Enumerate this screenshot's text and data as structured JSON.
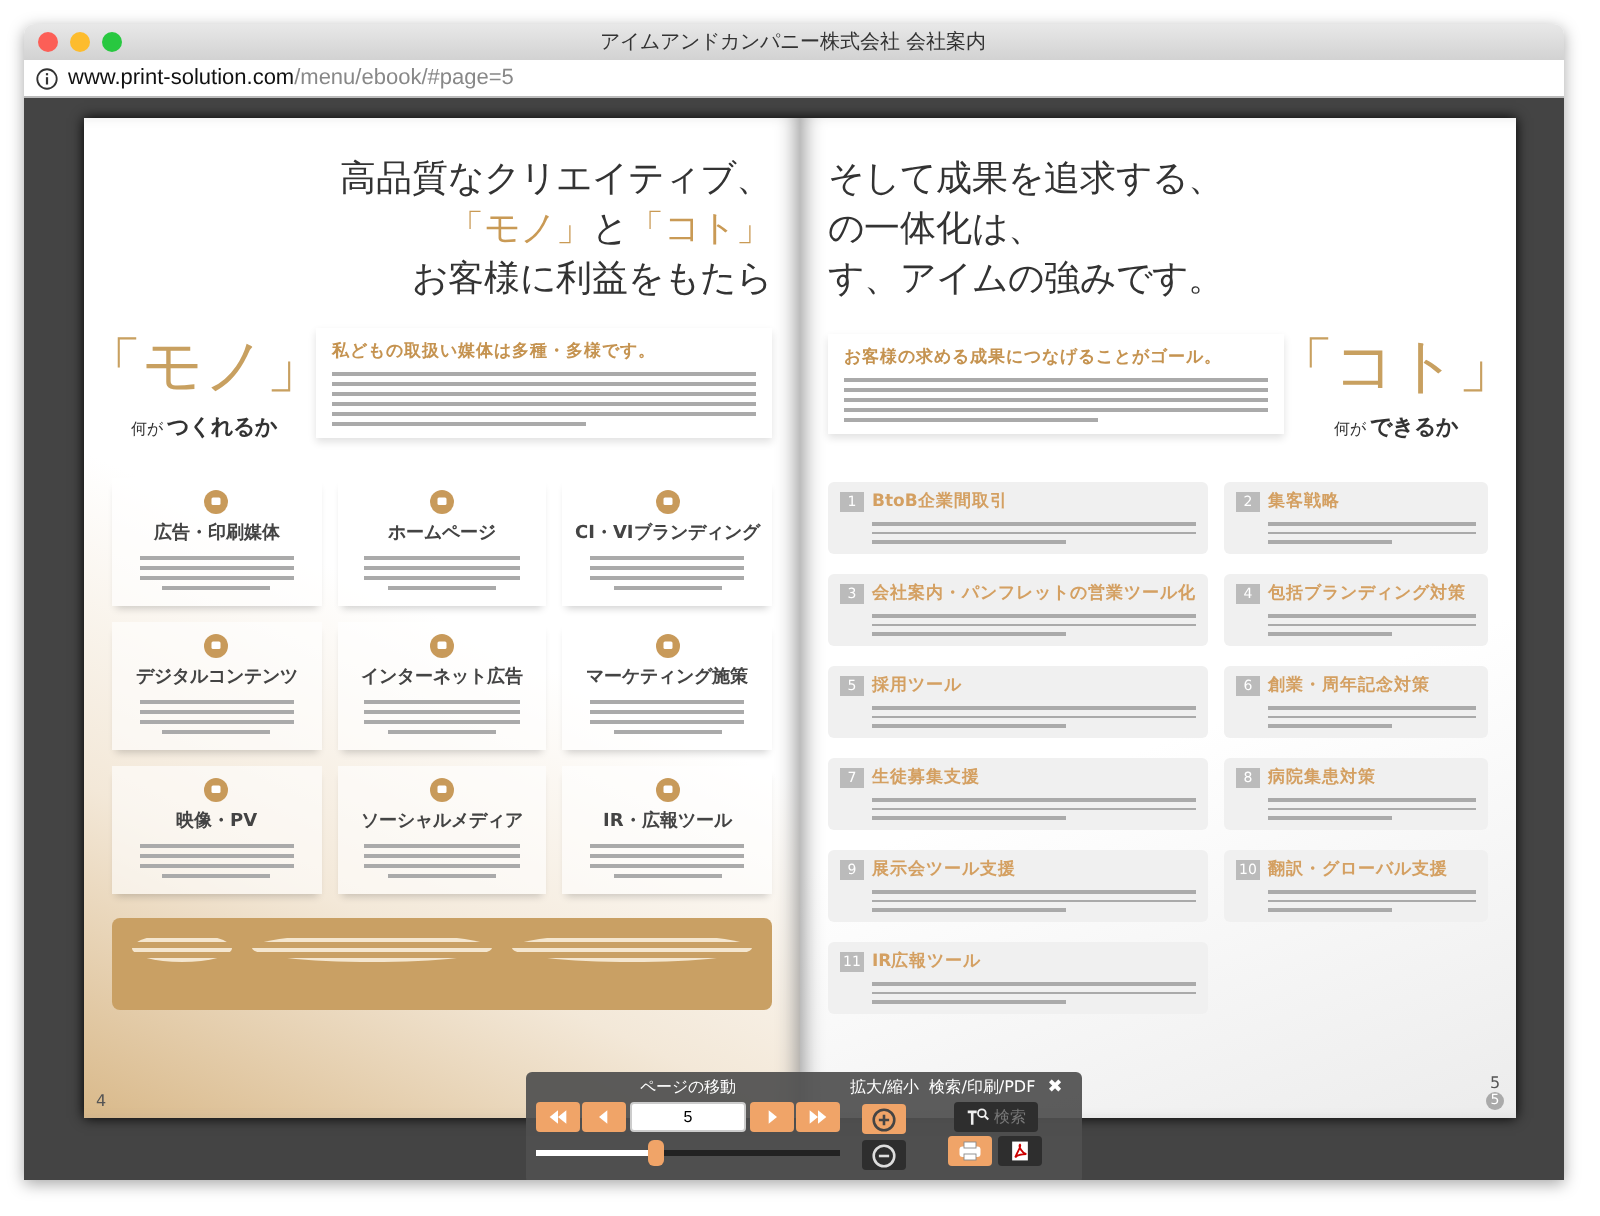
{
  "window": {
    "title": "アイムアンドカンパニー株式会社 会社案内",
    "url_host": "www.print-solution.com",
    "url_path": "/menu/ebook/#page=5"
  },
  "left_page": {
    "headline": [
      [
        {
          "text": "高品質なクリエイティブ、",
          "accent": false
        }
      ],
      [
        {
          "text": "「モノ」",
          "accent": true
        },
        {
          "text": "と",
          "accent": false
        },
        {
          "text": "「コト」",
          "accent": true
        }
      ],
      [
        {
          "text": "お客様に利益をもたら",
          "accent": false
        }
      ]
    ],
    "big_word": "「モノ」",
    "question_prefix": "何が",
    "question": "つくれるか",
    "lead": "私どもの取扱い媒体は多種・多様です。",
    "services": [
      {
        "title": "広告・印刷媒体"
      },
      {
        "title": "ホームページ"
      },
      {
        "title": "CI・VIブランディング"
      },
      {
        "title": "デジタルコンテンツ"
      },
      {
        "title": "インターネット広告"
      },
      {
        "title": "マーケティング施策"
      },
      {
        "title": "映像・PV"
      },
      {
        "title": "ソーシャルメディア"
      },
      {
        "title": "IR・広報ツール"
      }
    ],
    "page_number": "4"
  },
  "right_page": {
    "headline": [
      [
        {
          "text": "そして成果を追求する、",
          "accent": false
        }
      ],
      [
        {
          "text": "の一体化は、",
          "accent": false
        }
      ],
      [
        {
          "text": "す、アイムの強みです。",
          "accent": false
        }
      ]
    ],
    "lead": "お客様の求める成果につなげることがゴール。",
    "big_word": "「コト」",
    "question_prefix": "何が",
    "question": "できるか",
    "strengths": [
      {
        "number": "1",
        "title": "BtoB企業間取引"
      },
      {
        "number": "2",
        "title": "集客戦略"
      },
      {
        "number": "3",
        "title": "会社案内・パンフレットの営業ツール化"
      },
      {
        "number": "4",
        "title": "包括ブランディング対策"
      },
      {
        "number": "5",
        "title": "採用ツール"
      },
      {
        "number": "6",
        "title": "創業・周年記念対策"
      },
      {
        "number": "7",
        "title": "生徒募集支援"
      },
      {
        "number": "8",
        "title": "病院集患対策"
      },
      {
        "number": "9",
        "title": "展示会ツール支援"
      },
      {
        "number": "10",
        "title": "翻訳・グローバル支援"
      },
      {
        "number": "11",
        "title": "IR広報ツール"
      }
    ],
    "page_number": "5",
    "page_badge": "5"
  },
  "toolbar": {
    "page_label": "ページの移動",
    "zoom_label": "拡大/縮小",
    "tools_label": "検索/印刷/PDF",
    "close": "✖",
    "page_input": "5",
    "slider": {
      "level": 0.4
    },
    "search_button": {
      "label": "検索",
      "disabled": true
    }
  }
}
